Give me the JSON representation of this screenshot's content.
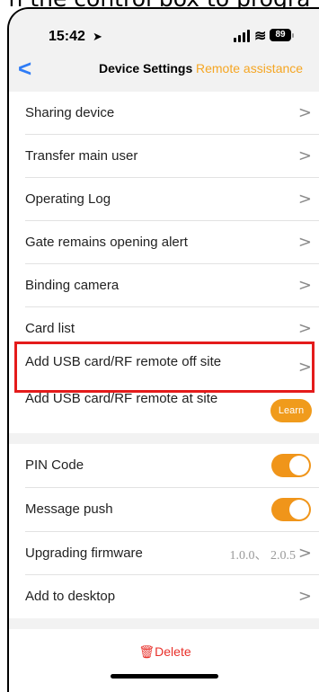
{
  "caption": "n the control box to progra",
  "status_bar": {
    "time": "15:42",
    "battery": "89"
  },
  "navbar": {
    "back": "<",
    "title": "Device Settings",
    "remote_assistance": "Remote assistance"
  },
  "group1": [
    {
      "label": "Sharing device"
    },
    {
      "label": "Transfer main user"
    },
    {
      "label": "Operating Log"
    },
    {
      "label": "Gate remains opening alert"
    },
    {
      "label": "Binding camera"
    },
    {
      "label": "Card list"
    },
    {
      "label": "Add USB card/RF remote off site"
    },
    {
      "label": "Add USB card/RF remote at site",
      "button": "Learn"
    }
  ],
  "group2": {
    "pin_code": {
      "label": "PIN Code",
      "enabled": true
    },
    "message_push": {
      "label": "Message push",
      "enabled": true
    },
    "upgrading_firmware": {
      "label": "Upgrading firmware",
      "version": "1.0.0、 2.0.5"
    },
    "add_to_desktop": {
      "label": "Add to desktop"
    }
  },
  "delete_label": "🗑Delete",
  "colors": {
    "accent": "#f5a623",
    "toggle": "#f0951a",
    "delete": "#e8302a",
    "highlight": "#e41b1b",
    "back": "#2f7cf6"
  },
  "chevron": ">"
}
